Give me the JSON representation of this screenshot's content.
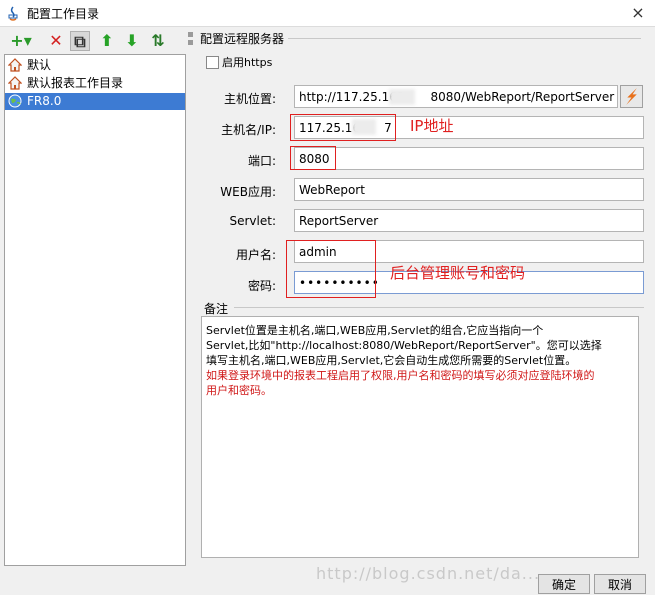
{
  "window": {
    "title": "配置工作目录",
    "close_glyph": "×"
  },
  "toolbar": {
    "buttons": [
      {
        "icon": "add-icon",
        "glyph": "+▾",
        "color": "#2a9a2a"
      },
      {
        "icon": "delete-icon",
        "glyph": "✕",
        "color": "#d42020"
      },
      {
        "icon": "copy-icon",
        "glyph": "⧉",
        "color": "#333333"
      },
      {
        "icon": "move-up-icon",
        "glyph": "⬆",
        "color": "#27a327"
      },
      {
        "icon": "move-down-icon",
        "glyph": "⬇",
        "color": "#27a327"
      },
      {
        "icon": "sort-icon",
        "glyph": "⇅",
        "color": "#2a7a2a"
      }
    ]
  },
  "tree": {
    "items": [
      {
        "label": "默认",
        "icon": "home-icon",
        "selected": false
      },
      {
        "label": "默认报表工作目录",
        "icon": "home-icon",
        "selected": false
      },
      {
        "label": "FR8.0",
        "icon": "globe-icon",
        "selected": true
      }
    ]
  },
  "form": {
    "group_title": "配置远程服务器",
    "https_label": "启用https",
    "host_label": "主机位置:",
    "host_value": "http://117.25.163",
    "host_value_tail": "8080/WebReport/ReportServer",
    "ip_label": "主机名/IP:",
    "ip_value": "117.25.16",
    "ip_value_tail": "7",
    "port_label": "端口:",
    "port_value": "8080",
    "web_label": "WEB应用:",
    "web_value": "WebReport",
    "servlet_label": "Servlet:",
    "servlet_value": "ReportServer",
    "user_label": "用户名:",
    "user_value": "admin",
    "password_label": "密码:",
    "password_value": "••••••••••"
  },
  "annotations": {
    "ip_note": "IP地址",
    "account_note": "后台管理账号和密码",
    "color": "#e02020"
  },
  "notes": {
    "title": "备注",
    "line1": "Servlet位置是主机名,端口,WEB应用,Servlet的组合,它应当指向一个",
    "line2": "Servlet,比如\"http://localhost:8080/WebReport/ReportServer\"。您可以选择",
    "line3": "填写主机名,端口,WEB应用,Servlet,它会自动生成您所需要的Servlet位置。",
    "red1": "如果登录环境中的报表工程启用了权限,用户名和密码的填写必须对应登陆环境的",
    "red2": "用户和密码。"
  },
  "buttons": {
    "ok": "确定",
    "cancel": "取消"
  },
  "watermark": "http://blog.csdn.net/da..."
}
